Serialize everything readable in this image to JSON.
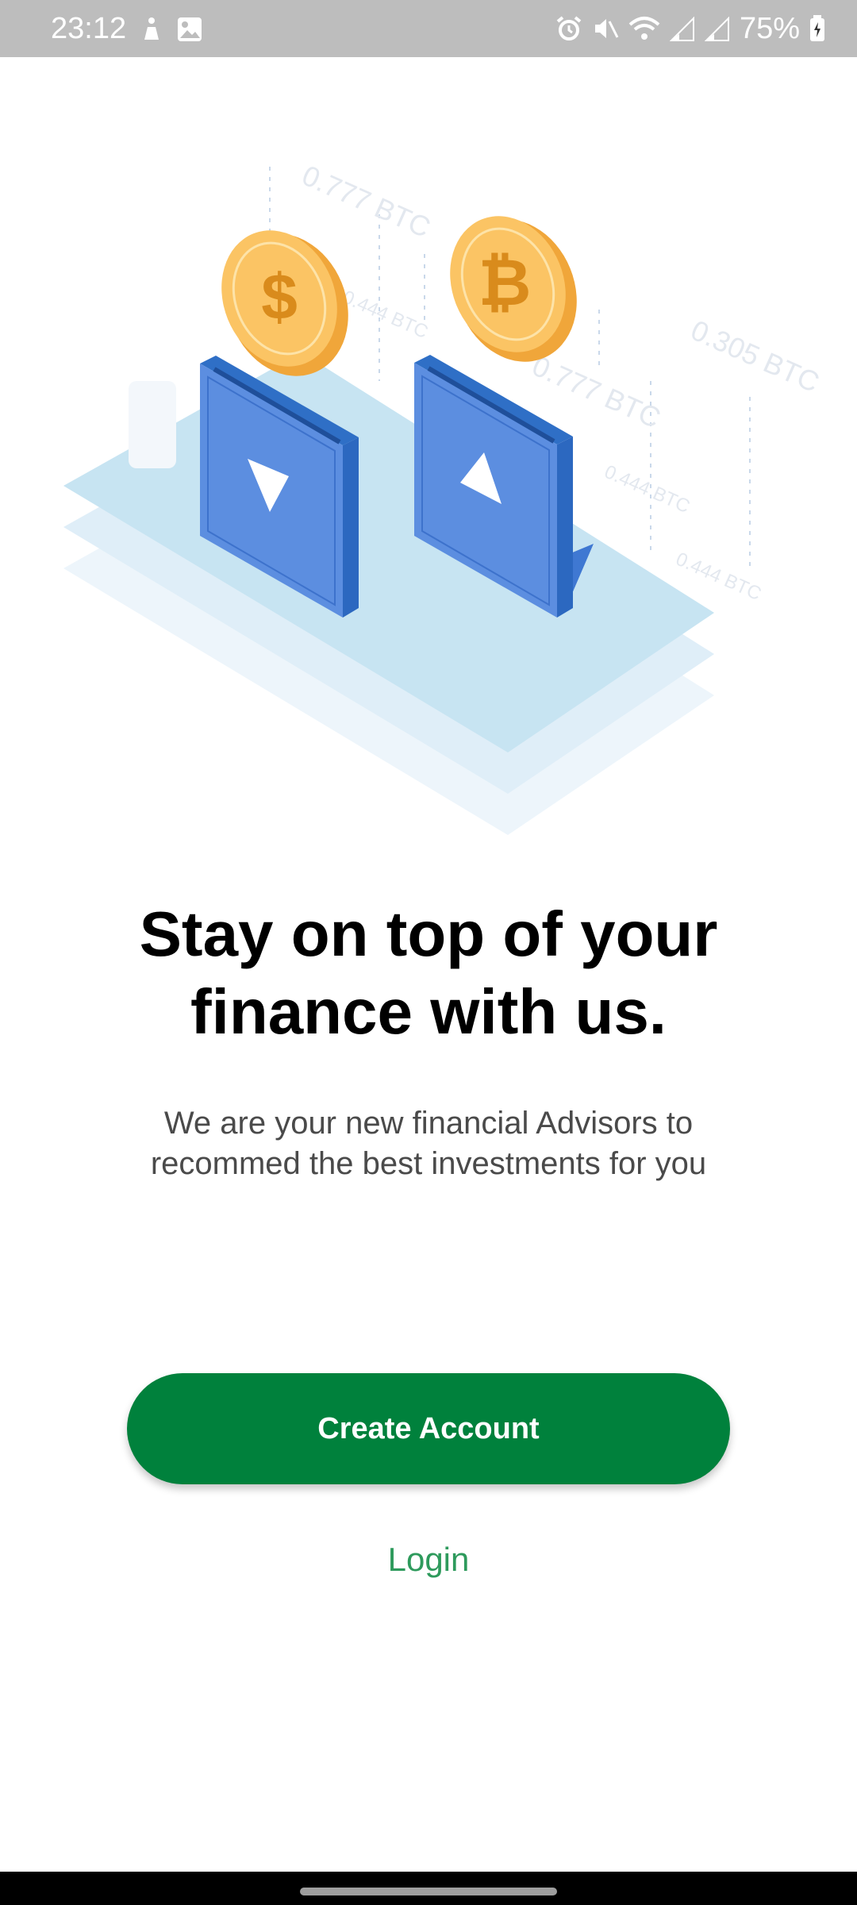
{
  "status_bar": {
    "time": "23:12",
    "battery": "75%",
    "icons": [
      "accessibility-icon",
      "gallery-icon",
      "alarm-icon",
      "mute-icon",
      "wifi-icon",
      "signal-icon",
      "signal-icon",
      "battery-icon"
    ]
  },
  "illustration": {
    "labels": [
      "0.777 BTC",
      "0.444 BTC",
      "0.777 BTC",
      "0.444 BTC",
      "0.305 BTC",
      "0.444 BTC"
    ],
    "coins": [
      "dollar-coin-icon",
      "bitcoin-coin-icon"
    ],
    "colors": {
      "panel": "#4a7fd8",
      "coin": "#f7b84a",
      "platform": "#bfe0f0"
    }
  },
  "onboarding": {
    "headline": "Stay on top of your finance with us.",
    "subtitle": "We are your new financial Advisors to recommed the best investments for you",
    "create_account_label": "Create Account",
    "login_label": "Login"
  },
  "colors": {
    "accent": "#00813c",
    "link": "#2e9a5c"
  }
}
